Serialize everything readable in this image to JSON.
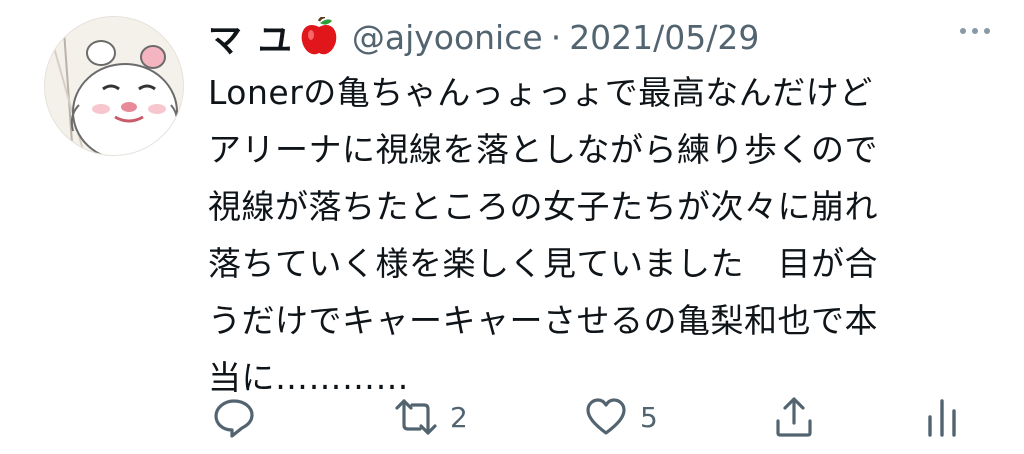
{
  "tweet": {
    "display_name": "マ ユ",
    "name_emoji_icon": "red-apple-icon",
    "handle": "@ajyoonice",
    "separator": "·",
    "date": "2021/05/29",
    "text_lines": [
      "Lonerの亀ちゃんっょっょで最高なんだけど",
      "アリーナに視線を落としながら練り歩くので",
      "視線が落ちたところの女子たちが次々に崩れ",
      "落ちていく様を楽しく見ていました　目が合",
      "うだけでキャーキャーさせるの亀梨和也で本",
      "当に…………"
    ]
  },
  "actions": {
    "reply_icon": "reply-icon",
    "retweet_icon": "retweet-icon",
    "retweet_count": "2",
    "like_icon": "heart-icon",
    "like_count": "5",
    "share_icon": "share-icon",
    "analytics_icon": "analytics-icon"
  },
  "colors": {
    "text": "#0f1419",
    "secondary": "#536471",
    "apple_red": "#e0161b"
  }
}
